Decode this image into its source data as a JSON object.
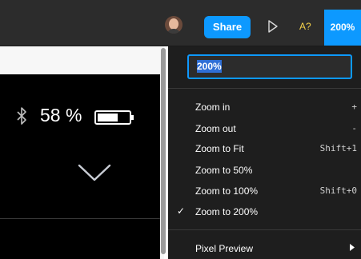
{
  "toolbar": {
    "share_label": "Share",
    "ai_label": "A?",
    "zoom_label": "200%"
  },
  "device": {
    "battery_percent": "58 %"
  },
  "zoom_menu": {
    "input_value": "200%",
    "items": [
      {
        "label": "Zoom in",
        "shortcut": "+"
      },
      {
        "label": "Zoom out",
        "shortcut": "-"
      },
      {
        "label": "Zoom to Fit",
        "shortcut": "Shift+1"
      },
      {
        "label": "Zoom to 50%",
        "shortcut": ""
      },
      {
        "label": "Zoom to 100%",
        "shortcut": "Shift+0"
      },
      {
        "label": "Zoom to 200%",
        "shortcut": "",
        "checked": true
      }
    ],
    "pixel_preview_label": "Pixel Preview"
  }
}
